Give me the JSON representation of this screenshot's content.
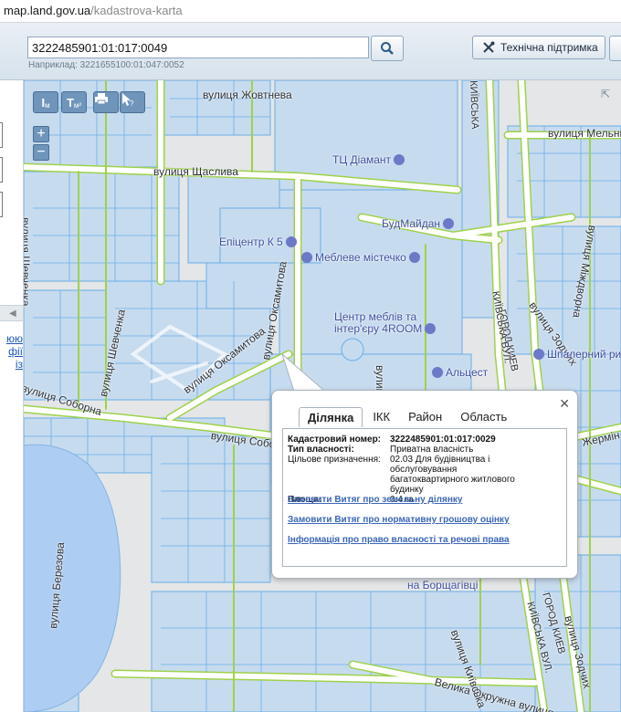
{
  "browser": {
    "host": "map.land.gov.ua",
    "path": "/kadastrova-karta"
  },
  "search": {
    "value": "3222485901:01:017:0049",
    "example": "Наприклад: 3221655100:01:047:0052"
  },
  "header": {
    "support_label": "Технічна підтримка"
  },
  "left_panel": {
    "collapse_glyph": "◀",
    "link_lines": [
      "юю",
      "фії",
      "із"
    ]
  },
  "tools": {
    "measure_length": "м",
    "measure_area": "м²",
    "zoom_in": "+",
    "zoom_out": "−"
  },
  "map": {
    "labels": {
      "street_zhovtneva": "вулиця Жовтнева",
      "street_shaslyva": "вулиця Щаслива",
      "street_shevchenka_top": "вулиця Шевченка",
      "street_shevchenka_mid": "вулиця Шевченка",
      "street_oksamytova_1": "вулиця Оксамитова",
      "street_oksamytova_2": "вулиця Оксамитова",
      "street_soborna_1": "вулиця Соборна",
      "street_soborna_2": "вулиця Собор",
      "street_melnychenka": "вулиця Мельниченка",
      "street_mizhdvirna": "вулиця Міждворна",
      "street_zodchykh_1": "вулиця Зодчих",
      "street_zodchykh_2": "вулиця Зодчих",
      "street_zhermin": "Жермін",
      "street_berezova": "вулиця Березова",
      "street_velyka_okruzhna": "Велика Окружна вулиця",
      "street_kyivska": "вулиця Київська",
      "street_vulytsia": "вулиця",
      "poi_diamant": "ТЦ Діамант",
      "poi_budmaidan": "БудМайдан",
      "poi_epicentr": "Епіцентр К 5",
      "poi_meblevemistechko": "Меблеве містечко",
      "poi_centr_mebliv_1": "Центр меблів та",
      "poi_centr_mebliv_2": "інтер'єру 4ROOM",
      "poi_shpalernyi": "Шпалерний ри",
      "poi_altsest": "Альцест",
      "poi_borshchagivka": "на Борщагівці",
      "city_kyiv_1": "ГОРОД КИЕВ",
      "city_kyiv_2": "ГОРОД КИЕВ",
      "kyivska_road_1": "КИЇВСЬКА ВУЛ.",
      "kyivska_road_2": "КИЇВСЬКА ВУЛ.",
      "kyivska_road_top": "КИЇВСЬКА"
    },
    "colors": {
      "parcel_fill": "#c7dbef",
      "parcel_stroke": "#68aee6",
      "road": "#ffffff",
      "road_border": "#9ed24a",
      "water": "#aecdf3",
      "base": "#e4e6e8"
    }
  },
  "popup": {
    "close_glyph": "✕",
    "tabs": [
      "Ділянка",
      "ІКК",
      "Район",
      "Область"
    ],
    "active_tab": "Ділянка",
    "fields": [
      {
        "key": "Кадастровий номер:",
        "value": "3222485901:01:017:0029"
      },
      {
        "key": "Тип власності:",
        "value": "Приватна власність"
      },
      {
        "key": "Цільове призначення:",
        "value": "02.03 Для будівництва і обслуговування багатоквартирного житлового будинку"
      },
      {
        "key": "Площа:",
        "value": "0.4 га"
      }
    ],
    "links": [
      "Замовити Витяг про земельну ділянку",
      "Замовити Витяг про нормативну грошову оцінку",
      "Інформація про право власності та речові права"
    ]
  }
}
